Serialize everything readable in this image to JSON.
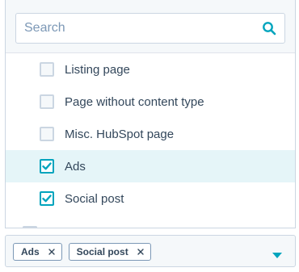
{
  "search": {
    "placeholder": "Search",
    "value": ""
  },
  "options": [
    {
      "label": "Listing page",
      "checked": false
    },
    {
      "label": "Page without content type",
      "checked": false
    },
    {
      "label": "Misc. HubSpot page",
      "checked": false
    },
    {
      "label": "Ads",
      "checked": true
    },
    {
      "label": "Social post",
      "checked": true
    }
  ],
  "selected_tags": [
    {
      "label": "Ads"
    },
    {
      "label": "Social post"
    }
  ],
  "icons": {
    "search": "search-icon",
    "check": "checkmark-icon",
    "remove": "close-icon",
    "caret": "caret-down-icon"
  },
  "colors": {
    "accent": "#00a4bd",
    "text": "#33475b",
    "border": "#cbd6e2",
    "highlight": "#e5f5f8",
    "muted_bg": "#f5f8fa"
  }
}
